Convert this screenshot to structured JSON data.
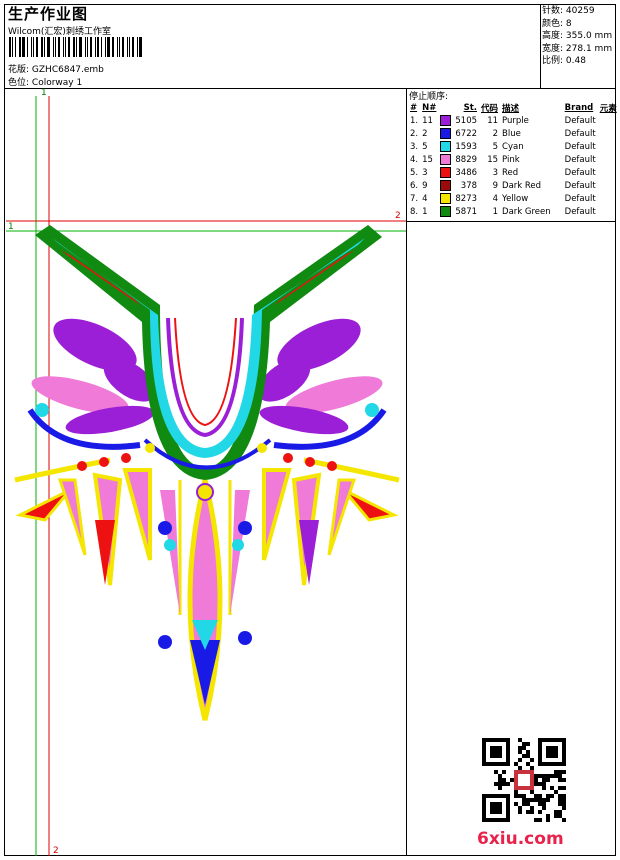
{
  "header": {
    "title": "生产作业图",
    "studio": "Wilcom(汇宏)刺绣工作室",
    "design_label": "花版:",
    "design_name": "GZHC6847.emb",
    "colorway_label": "色位:",
    "colorway_name": "Colorway 1"
  },
  "specs": [
    {
      "label": "针数:",
      "value": "40259"
    },
    {
      "label": "颜色:",
      "value": "8"
    },
    {
      "label": "高度:",
      "value": "355.0 mm"
    },
    {
      "label": "宽度:",
      "value": "278.1 mm"
    },
    {
      "label": "比例:",
      "value": "0.48"
    }
  ],
  "legend": {
    "title": "停止顺序:",
    "headers": [
      "#",
      "N#",
      "St.",
      "代码",
      "描述",
      "Brand",
      "元素"
    ],
    "rows": [
      {
        "idx": "1.",
        "n": "11",
        "color": "#9b1fd6",
        "st": "5105",
        "code": "11",
        "desc": "Purple",
        "brand": "Default"
      },
      {
        "idx": "2.",
        "n": "2",
        "color": "#1a1ae6",
        "st": "6722",
        "code": "2",
        "desc": "Blue",
        "brand": "Default"
      },
      {
        "idx": "3.",
        "n": "5",
        "color": "#22d8e6",
        "st": "1593",
        "code": "5",
        "desc": "Cyan",
        "brand": "Default"
      },
      {
        "idx": "4.",
        "n": "15",
        "color": "#f07ad8",
        "st": "8829",
        "code": "15",
        "desc": "Pink",
        "brand": "Default"
      },
      {
        "idx": "5.",
        "n": "3",
        "color": "#ee1111",
        "st": "3486",
        "code": "3",
        "desc": "Red",
        "brand": "Default"
      },
      {
        "idx": "6.",
        "n": "9",
        "color": "#9a0b0b",
        "st": "378",
        "code": "9",
        "desc": "Dark Red",
        "brand": "Default"
      },
      {
        "idx": "7.",
        "n": "4",
        "color": "#f4e600",
        "st": "8273",
        "code": "4",
        "desc": "Yellow",
        "brand": "Default"
      },
      {
        "idx": "8.",
        "n": "1",
        "color": "#118a11",
        "st": "5871",
        "code": "1",
        "desc": "Dark Green",
        "brand": "Default"
      }
    ]
  },
  "markers": {
    "m1a": "1",
    "m1b": "1",
    "m2a": "2",
    "m2b": "2"
  },
  "watermark": {
    "site": "6xiu.com"
  }
}
